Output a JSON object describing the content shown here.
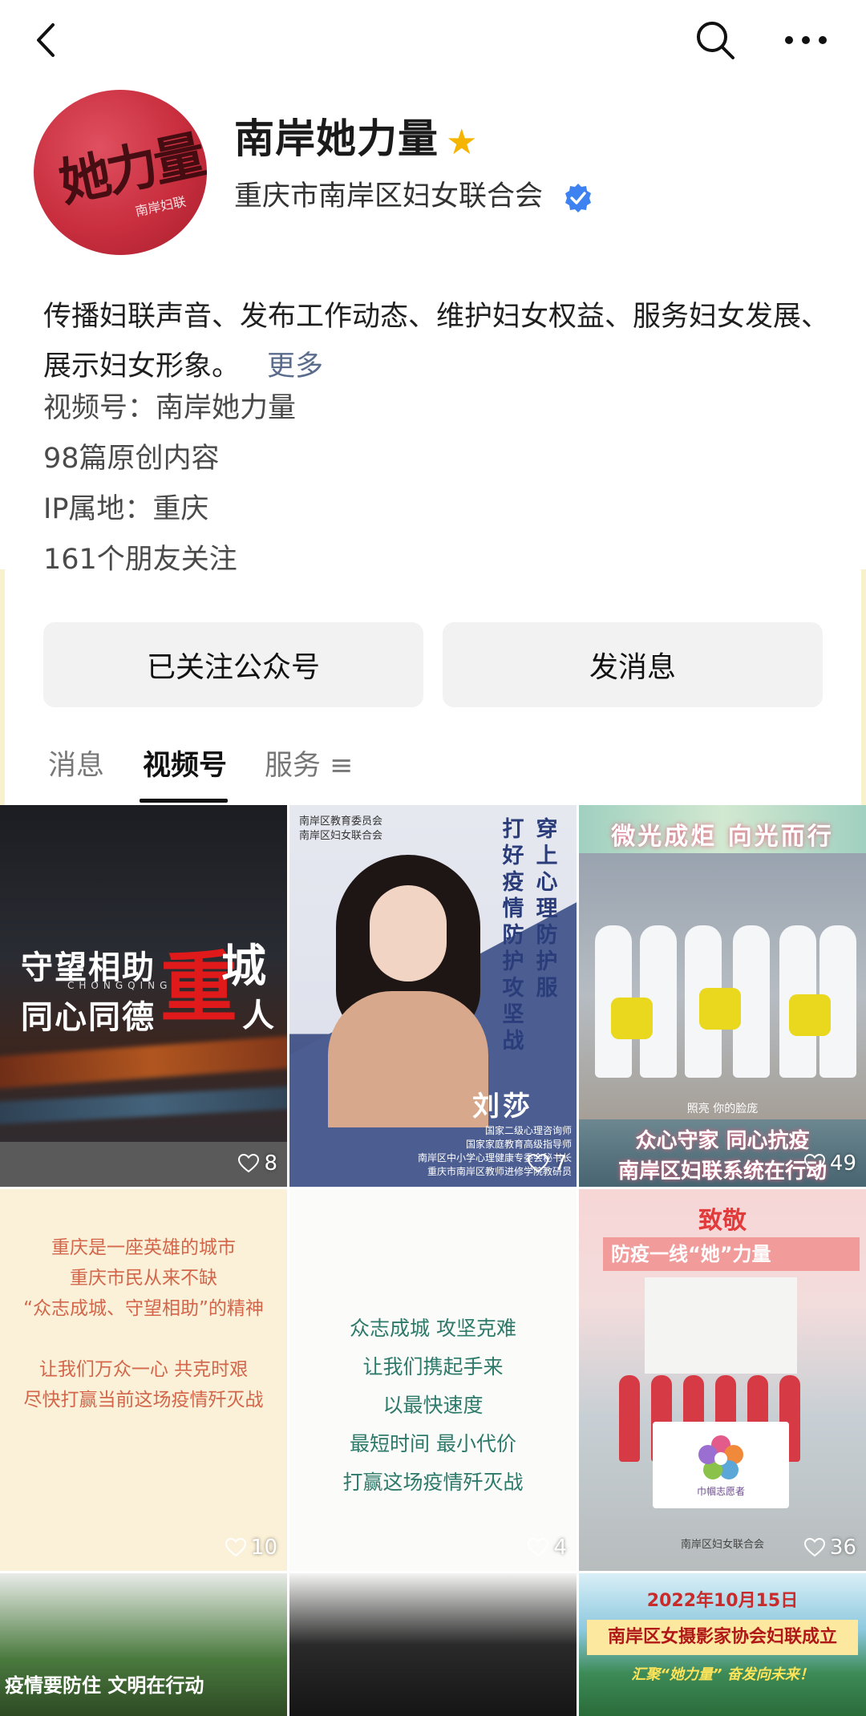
{
  "profile": {
    "name": "南岸她力量",
    "organization": "重庆市南岸区妇女联合会",
    "avatar_text": "她力量",
    "avatar_sub": "南岸妇联",
    "bio": "传播妇联声音、发布工作动态、维护妇女权益、服务妇女发展、展示妇女形象。",
    "bio_more": "更多",
    "video_account": "视频号：南岸她力量",
    "original_count": "98篇原创内容",
    "ip_location": "IP属地：重庆",
    "friends_following": "161个朋友关注"
  },
  "actions": {
    "follow_label": "已关注公众号",
    "message_label": "发消息"
  },
  "tabs": [
    {
      "label": "消息"
    },
    {
      "label": "视频号",
      "active": true
    },
    {
      "label": "服务 ≡"
    }
  ],
  "videos": [
    {
      "likes": "8",
      "line1": "守望相助",
      "line2": "同心同德",
      "brand": "CHONGQING",
      "big": "重",
      "city": "城",
      "ren": "人"
    },
    {
      "likes": "7",
      "header": "南岸区教育委员会\n南岸区妇女联合会",
      "col1": "打好疫情防护攻坚战",
      "col2": "穿上心理防护服",
      "name": "刘莎",
      "title": "国家二级心理咨询师\n国家家庭教育高级指导师\n南岸区中小学心理健康专委会秘书长\n重庆市南岸区教师进修学院教研员"
    },
    {
      "likes": "49",
      "top": "微光成炬 向光而行",
      "caption": "照亮 你的脸庞",
      "bottom1": "众心守家 同心抗疫",
      "bottom2": "南岸区妇联系统在行动"
    },
    {
      "likes": "10",
      "text": "重庆是一座英雄的城市\n重庆市民从来不缺\n“众志成城、守望相助”的精神\n\n让我们万众一心 共克时艰\n尽快打赢当前这场疫情歼灭战"
    },
    {
      "likes": "4",
      "text": "众志成城 攻坚克难\n让我们携起手来\n以最快速度\n最短时间 最小代价\n打赢这场疫情歼灭战"
    },
    {
      "likes": "36",
      "heading": "致敬",
      "subheading": "防疫一线“她”力量",
      "banner": "巾帼志愿者",
      "footer": "南岸区妇女联合会"
    },
    {
      "title": "疫情要防住 文明在行动"
    },
    {},
    {
      "date": "2022年10月15日",
      "band": "南岸区女摄影家协会妇联成立",
      "sub": "汇聚“她力量” 奋发向未来！"
    }
  ],
  "colors": {
    "accent_blue": "#3d82f0",
    "star": "#f4b400",
    "more_link": "#5a6c8c"
  }
}
